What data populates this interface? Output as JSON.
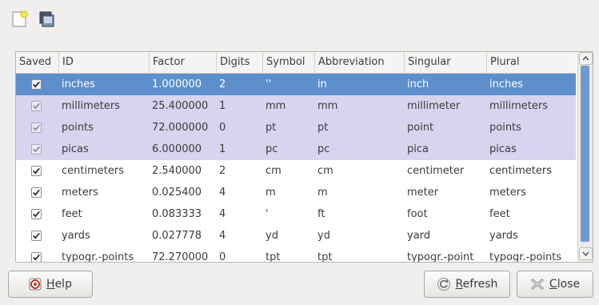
{
  "toolbar": {
    "new_icon": "new-document-icon",
    "other_icon": "window-icon"
  },
  "table": {
    "headers": [
      "Saved",
      "ID",
      "Factor",
      "Digits",
      "Symbol",
      "Abbreviation",
      "Singular",
      "Plural"
    ],
    "rows": [
      {
        "id": "inches",
        "factor": "1.000000",
        "digits": "2",
        "symbol": "''",
        "abbr": "in",
        "singular": "inch",
        "plural": "inches",
        "saved": true,
        "style": "sel"
      },
      {
        "id": "millimeters",
        "factor": "25.400000",
        "digits": "1",
        "symbol": "mm",
        "abbr": "mm",
        "singular": "millimeter",
        "plural": "millimeters",
        "saved": true,
        "style": "lav"
      },
      {
        "id": "points",
        "factor": "72.000000",
        "digits": "0",
        "symbol": "pt",
        "abbr": "pt",
        "singular": "point",
        "plural": "points",
        "saved": true,
        "style": "lav"
      },
      {
        "id": "picas",
        "factor": "6.000000",
        "digits": "1",
        "symbol": "pc",
        "abbr": "pc",
        "singular": "pica",
        "plural": "picas",
        "saved": true,
        "style": "lav"
      },
      {
        "id": "centimeters",
        "factor": "2.540000",
        "digits": "2",
        "symbol": "cm",
        "abbr": "cm",
        "singular": "centimeter",
        "plural": "centimeters",
        "saved": true,
        "style": "white"
      },
      {
        "id": "meters",
        "factor": "0.025400",
        "digits": "4",
        "symbol": "m",
        "abbr": "m",
        "singular": "meter",
        "plural": "meters",
        "saved": true,
        "style": "white"
      },
      {
        "id": "feet",
        "factor": "0.083333",
        "digits": "4",
        "symbol": "'",
        "abbr": "ft",
        "singular": "foot",
        "plural": "feet",
        "saved": true,
        "style": "white"
      },
      {
        "id": "yards",
        "factor": "0.027778",
        "digits": "4",
        "symbol": "yd",
        "abbr": "yd",
        "singular": "yard",
        "plural": "yards",
        "saved": true,
        "style": "white"
      },
      {
        "id": "typogr.-points",
        "factor": "72.270000",
        "digits": "0",
        "symbol": "tpt",
        "abbr": "tpt",
        "singular": "typogr.-point",
        "plural": "typogr.-points",
        "saved": true,
        "style": "white"
      }
    ]
  },
  "buttons": {
    "help": {
      "mnemonic": "H",
      "rest": "elp",
      "icon": "help-icon"
    },
    "refresh": {
      "mnemonic": "R",
      "rest": "efresh",
      "icon": "refresh-icon"
    },
    "close": {
      "mnemonic": "C",
      "rest": "lose",
      "icon": "close-icon"
    }
  },
  "colors": {
    "selection": "#5c8fcc",
    "saved_row": "#d6d4ee",
    "scroll_thumb": "#6f9ad0"
  }
}
